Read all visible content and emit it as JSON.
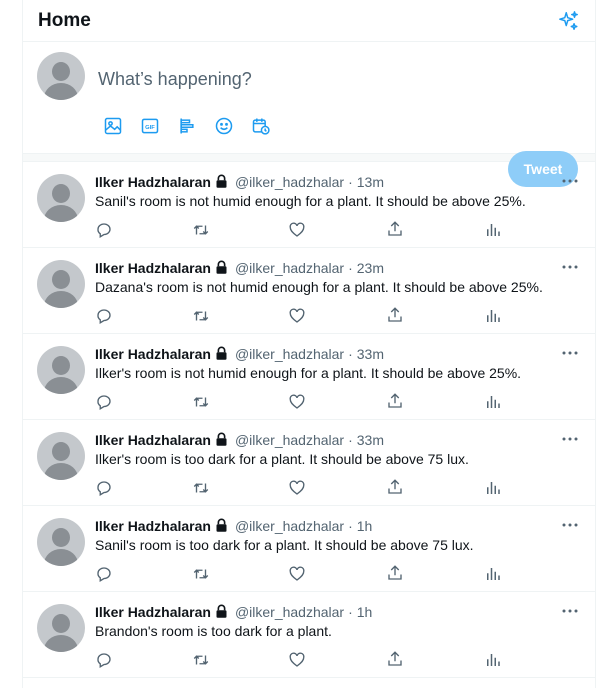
{
  "header": {
    "title": "Home",
    "icon": "sparkle-icon"
  },
  "composer": {
    "placeholder": "What’s happening?",
    "tools": [
      "image-icon",
      "gif-icon",
      "poll-icon",
      "emoji-icon",
      "schedule-icon"
    ],
    "tweet_label": "Tweet"
  },
  "tweets": [
    {
      "name": "Ilker Hadzhalaran",
      "handle": "@ilker_hadzhalar",
      "sep": "·",
      "time": "13m",
      "text": "Sanil's room is not humid enough for a plant. It should be above 25%."
    },
    {
      "name": "Ilker Hadzhalaran",
      "handle": "@ilker_hadzhalar",
      "sep": "·",
      "time": "23m",
      "text": "Dazana's room is not humid enough for a plant. It should be above 25%."
    },
    {
      "name": "Ilker Hadzhalaran",
      "handle": "@ilker_hadzhalar",
      "sep": "·",
      "time": "33m",
      "text": "Ilker's room is not humid enough for a plant. It should be above 25%."
    },
    {
      "name": "Ilker Hadzhalaran",
      "handle": "@ilker_hadzhalar",
      "sep": "·",
      "time": "33m",
      "text": "Ilker's room is too dark for a plant. It should be above 75 lux."
    },
    {
      "name": "Ilker Hadzhalaran",
      "handle": "@ilker_hadzhalar",
      "sep": "·",
      "time": "1h",
      "text": "Sanil's room is too dark for a plant. It should be above 75 lux."
    },
    {
      "name": "Ilker Hadzhalaran",
      "handle": "@ilker_hadzhalar",
      "sep": "·",
      "time": "1h",
      "text": "Brandon's room is too dark for a plant."
    }
  ],
  "tweet_actions": [
    "reply-icon",
    "retweet-icon",
    "like-icon",
    "share-icon",
    "analytics-icon"
  ],
  "colors": {
    "accent": "#1d9bf0",
    "tweet_button_disabled": "#8ecdf8",
    "secondary_text": "#536471"
  }
}
